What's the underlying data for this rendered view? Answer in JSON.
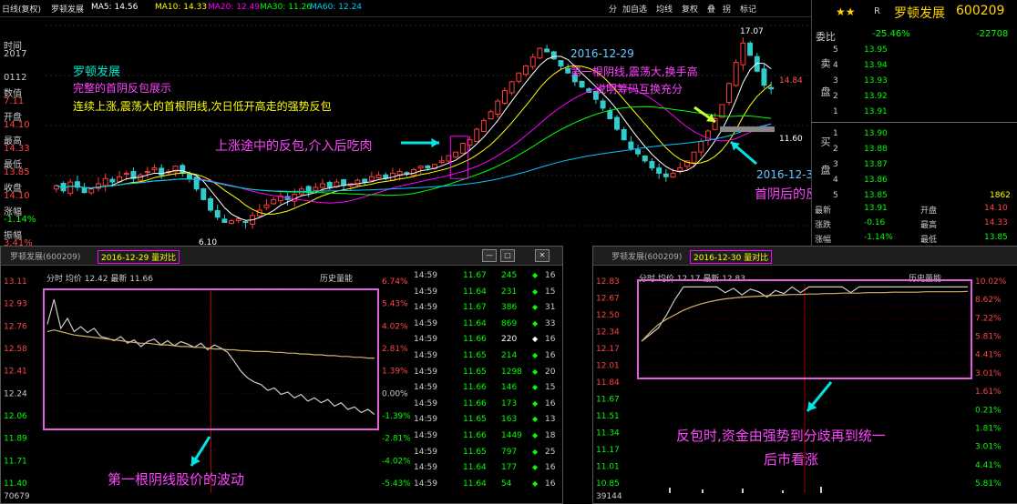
{
  "top_bar": {
    "left_label": "日线(复权)",
    "stock": "罗顿发展",
    "ma5": "MA5: 14.56",
    "ma10": "MA10: 14.33",
    "ma20": "MA20: 12.49",
    "ma30": "MA30: 11.26",
    "ma60": "MA60: 12.24",
    "toolbar": [
      "分",
      "加自选",
      "均线",
      "复权",
      "叠",
      "拐",
      "标记"
    ],
    "colors": {
      "ma5": "#ffffff",
      "ma10": "#ffff00",
      "ma20": "#ff00ff",
      "ma30": "#00ff00",
      "ma60": "#00c8ff"
    }
  },
  "left_info": [
    {
      "label": "时间",
      "value": "2017"
    },
    {
      "label": "",
      "value": "0112"
    },
    {
      "label": "数值",
      "value": "7.11"
    },
    {
      "label": "开盘",
      "value": "14.10"
    },
    {
      "label": "最高",
      "value": "14.33"
    },
    {
      "label": "最低",
      "value": "13.85"
    },
    {
      "label": "收盘",
      "value": "14.10"
    },
    {
      "label": "涨幅",
      "value": "-1.14%"
    },
    {
      "label": "振幅",
      "value": "3.41%"
    }
  ],
  "order_book": {
    "stars": "★★",
    "flag": "R",
    "name": "罗顿发展",
    "code": "600209",
    "ratio_label": "委比",
    "ratio_value": "-25.46%",
    "ratio_diff": "-22708",
    "sell_label": "卖盘",
    "buy_label": "买盘",
    "sell": [
      {
        "level": "5",
        "price": "13.95"
      },
      {
        "level": "4",
        "price": "13.94"
      },
      {
        "level": "3",
        "price": "13.93"
      },
      {
        "level": "2",
        "price": "13.92"
      },
      {
        "level": "1",
        "price": "13.91"
      }
    ],
    "buy": [
      {
        "level": "1",
        "price": "13.90"
      },
      {
        "level": "2",
        "price": "13.88"
      },
      {
        "level": "3",
        "price": "13.87"
      },
      {
        "level": "4",
        "price": "13.86"
      },
      {
        "level": "5",
        "price": "13.85",
        "volume": "1862"
      }
    ],
    "stats": [
      {
        "l1": "最新",
        "v1": "13.91",
        "l2": "开盘",
        "v2": "14.10"
      },
      {
        "l1": "涨跌",
        "v1": "-0.16",
        "l2": "最高",
        "v2": "14.33"
      },
      {
        "l1": "涨幅",
        "v1": "-1.14%",
        "l2": "最低",
        "v2": "13.85"
      }
    ]
  },
  "main_chart": {
    "price_labels": {
      "high": "17.07",
      "low": "6.10",
      "mid_left": "14.84",
      "mid_right": "11.60"
    },
    "annotations": {
      "a1": "罗顿发展",
      "a2": "完整的首阴反包展示",
      "a3": "连续上涨,震荡大的首根阴线,次日低开高走的强势反包",
      "a4": "上涨途中的反包,介入后吃肉",
      "a5_date": "2016-12-29",
      "a5_l1": "第一根阴线,震荡大,换手高",
      "a5_l2": "说明筹码互换充分",
      "a6_date": "2016-12-30",
      "a6_l1": "首阴后的反包"
    }
  },
  "chart_data": [
    {
      "type": "candlestick",
      "title": "罗顿发展",
      "ylim": [
        5.5,
        17.5
      ],
      "high_label": 17.07,
      "low_label": 6.1,
      "close": [
        8.4,
        8.1,
        8.6,
        8.3,
        8.0,
        8.2,
        8.5,
        8.8,
        8.6,
        8.9,
        9.1,
        8.8,
        9.0,
        9.2,
        9.4,
        9.0,
        9.2,
        9.5,
        9.1,
        8.8,
        8.2,
        7.6,
        7.0,
        6.6,
        6.3,
        6.4,
        6.5,
        6.3,
        6.7,
        7.0,
        7.3,
        7.6,
        7.8,
        7.6,
        7.9,
        8.2,
        8.0,
        8.3,
        8.5,
        8.3,
        8.6,
        8.4,
        8.5,
        8.7,
        8.6,
        8.9,
        9.0,
        8.8,
        9.1,
        9.2,
        9.1,
        9.3,
        9.5,
        9.4,
        9.6,
        9.8,
        10.1,
        10.3,
        10.8,
        11.0,
        11.6,
        12.1,
        12.6,
        13.2,
        13.8,
        14.3,
        14.8,
        15.2,
        15.7,
        16.2,
        16.0,
        15.6,
        15.2,
        14.8,
        14.3,
        14.0,
        13.7,
        13.3,
        12.8,
        12.2,
        11.6,
        11.0,
        10.5,
        10.2,
        9.8,
        9.4,
        9.1,
        8.9,
        9.1,
        9.4,
        9.8,
        10.3,
        10.9,
        11.5,
        12.2,
        13.0,
        14.2,
        15.4,
        16.5,
        15.8,
        14.9,
        14.1,
        13.9
      ],
      "series": [
        {
          "name": "MA5",
          "color": "#ffffff"
        },
        {
          "name": "MA10",
          "color": "#ffff00"
        },
        {
          "name": "MA20",
          "color": "#ff00ff"
        },
        {
          "name": "MA30",
          "color": "#00ff00"
        },
        {
          "name": "MA60",
          "color": "#00c8ff"
        }
      ]
    },
    {
      "type": "line",
      "title": "2016-12-29 量对比",
      "window_name": "罗顿发展(600209)",
      "header": "分时 均价 12.42 最新 11.66",
      "history_label": "历史量能",
      "y_ticks": [
        "13.11",
        "12.93",
        "12.76",
        "12.58",
        "12.41",
        "12.24",
        "12.06",
        "11.89",
        "11.71",
        "11.40"
      ],
      "pct_ticks": [
        "6.74%",
        "5.43%",
        "4.02%",
        "2.81%",
        "1.39%",
        "0.00%",
        "-1.39%",
        "-2.81%",
        "-4.02%",
        "-5.43%"
      ],
      "bottom_value": "70679",
      "ylim": [
        11.5,
        13.15
      ],
      "series": [
        {
          "name": "分时",
          "color": "#cccccc",
          "values": [
            12.75,
            13.05,
            12.7,
            12.82,
            12.66,
            12.72,
            12.65,
            12.7,
            12.6,
            12.58,
            12.55,
            12.6,
            12.52,
            12.56,
            12.48,
            12.54,
            12.57,
            12.5,
            12.55,
            12.49,
            12.54,
            12.51,
            12.47,
            12.52,
            12.44,
            12.5,
            12.46,
            12.41,
            12.3,
            12.18,
            12.1,
            12.05,
            12.02,
            11.95,
            11.98,
            11.9,
            11.93,
            11.86,
            11.9,
            11.82,
            11.86,
            11.8,
            11.84,
            11.76,
            11.8,
            11.72,
            11.75,
            11.68,
            11.72,
            11.66
          ]
        },
        {
          "name": "均价",
          "color": "#d4b06a",
          "values": [
            12.66,
            12.68,
            12.66,
            12.64,
            12.62,
            12.61,
            12.6,
            12.59,
            12.58,
            12.57,
            12.56,
            12.55,
            12.54,
            12.53,
            12.52,
            12.52,
            12.51,
            12.5,
            12.5,
            12.49,
            12.48,
            12.48,
            12.47,
            12.47,
            12.46,
            12.45,
            12.45,
            12.44,
            12.44,
            12.43,
            12.43,
            12.42,
            12.42,
            12.42,
            12.41,
            12.41,
            12.4,
            12.4,
            12.39,
            12.39,
            12.38,
            12.38,
            12.37,
            12.37,
            12.36,
            12.36,
            12.35,
            12.35,
            12.34,
            12.34
          ]
        }
      ]
    },
    {
      "type": "table",
      "title": "分时成交",
      "rows": [
        {
          "time": "14:59",
          "price": "11.67",
          "vol": "245",
          "n": "16",
          "dir": "S"
        },
        {
          "time": "14:59",
          "price": "11.64",
          "vol": "231",
          "n": "15",
          "dir": "S"
        },
        {
          "time": "14:59",
          "price": "11.67",
          "vol": "386",
          "n": "31",
          "dir": "S"
        },
        {
          "time": "14:59",
          "price": "11.64",
          "vol": "869",
          "n": "33",
          "dir": "S"
        },
        {
          "time": "14:59",
          "price": "11.66",
          "vol": "220",
          "n": "16",
          "dir": "N"
        },
        {
          "time": "14:59",
          "price": "11.65",
          "vol": "214",
          "n": "16",
          "dir": "S"
        },
        {
          "time": "14:59",
          "price": "11.65",
          "vol": "1298",
          "n": "20",
          "dir": "S"
        },
        {
          "time": "14:59",
          "price": "11.66",
          "vol": "146",
          "n": "15",
          "dir": "S"
        },
        {
          "time": "14:59",
          "price": "11.66",
          "vol": "173",
          "n": "16",
          "dir": "S"
        },
        {
          "time": "14:59",
          "price": "11.65",
          "vol": "163",
          "n": "13",
          "dir": "S"
        },
        {
          "time": "14:59",
          "price": "11.66",
          "vol": "1449",
          "n": "18",
          "dir": "S"
        },
        {
          "time": "14:59",
          "price": "11.65",
          "vol": "797",
          "n": "25",
          "dir": "S"
        },
        {
          "time": "14:59",
          "price": "11.64",
          "vol": "177",
          "n": "16",
          "dir": "S"
        },
        {
          "time": "14:59",
          "price": "11.64",
          "vol": "54",
          "n": "16",
          "dir": "S"
        }
      ]
    },
    {
      "type": "line",
      "title": "2016-12-30 量对比",
      "window_name": "罗顿发展(600209)",
      "header": "分时 均价 12.17 最新 12.83",
      "history_label": "历史量能",
      "y_ticks": [
        "12.83",
        "12.67",
        "12.50",
        "12.34",
        "12.17",
        "12.01",
        "11.84",
        "11.67",
        "11.51",
        "11.34",
        "11.17",
        "11.01",
        "10.85"
      ],
      "pct_ticks": [
        "10.02%",
        "8.62%",
        "7.22%",
        "5.81%",
        "4.41%",
        "3.01%",
        "1.61%",
        "0.21%",
        "1.81%",
        "3.01%",
        "4.41%",
        "5.81%"
      ],
      "bottom_value": "39144",
      "ylim": [
        10.8,
        12.9
      ],
      "series": [
        {
          "name": "分时",
          "color": "#cccccc",
          "values": [
            11.6,
            11.75,
            11.9,
            12.2,
            12.55,
            12.83,
            12.83,
            12.83,
            12.83,
            12.83,
            12.7,
            12.8,
            12.65,
            12.78,
            12.72,
            12.6,
            12.75,
            12.68,
            12.83,
            12.7,
            12.83,
            12.83,
            12.83,
            12.83,
            12.83,
            12.7,
            12.83,
            12.83,
            12.83,
            12.83,
            12.83,
            12.83,
            12.83,
            12.83,
            12.83,
            12.83,
            12.83,
            12.83,
            12.83,
            12.83
          ]
        },
        {
          "name": "均价",
          "color": "#d4b06a",
          "values": [
            11.6,
            11.8,
            11.98,
            12.1,
            12.2,
            12.3,
            12.38,
            12.44,
            12.49,
            12.53,
            12.56,
            12.58,
            12.6,
            12.61,
            12.62,
            12.63,
            12.64,
            12.65,
            12.66,
            12.66,
            12.67,
            12.67,
            12.68,
            12.68,
            12.69,
            12.69,
            12.69,
            12.7,
            12.7,
            12.7,
            12.71,
            12.71,
            12.71,
            12.71,
            12.72,
            12.72,
            12.72,
            12.72,
            12.72,
            12.73
          ]
        }
      ]
    }
  ],
  "bottom_annotations": {
    "left": "第一根阴线股价的波动",
    "right_l1": "反包时,资金由强势到分歧再到统一",
    "right_l2": "后市看涨"
  },
  "win_buttons": {
    "min": "—",
    "max": "□",
    "close": "✕"
  }
}
